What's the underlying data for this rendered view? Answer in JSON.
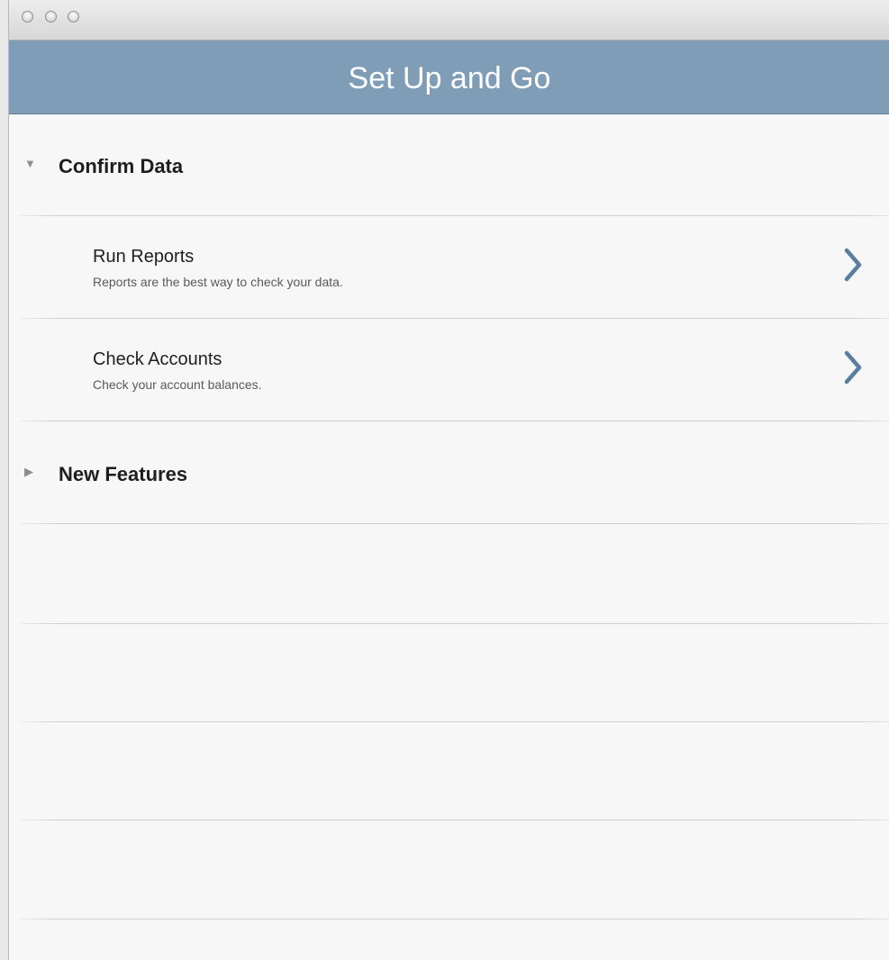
{
  "window": {
    "title_bar_buttons": [
      "close",
      "minimize",
      "zoom"
    ]
  },
  "header": {
    "title": "Set Up and Go",
    "background_color": "#7f9db6"
  },
  "sections": [
    {
      "title": "Confirm Data",
      "expanded": true,
      "disclosure_icon": "triangle-down-icon",
      "items": [
        {
          "title": "Run Reports",
          "subtitle": "Reports are the best way to check your data.",
          "icon": "chevron-right-icon"
        },
        {
          "title": "Check Accounts",
          "subtitle": "Check your account balances.",
          "icon": "chevron-right-icon"
        }
      ]
    },
    {
      "title": "New Features",
      "expanded": false,
      "disclosure_icon": "triangle-right-icon",
      "items": []
    }
  ],
  "accent_color": "#5a7da0"
}
